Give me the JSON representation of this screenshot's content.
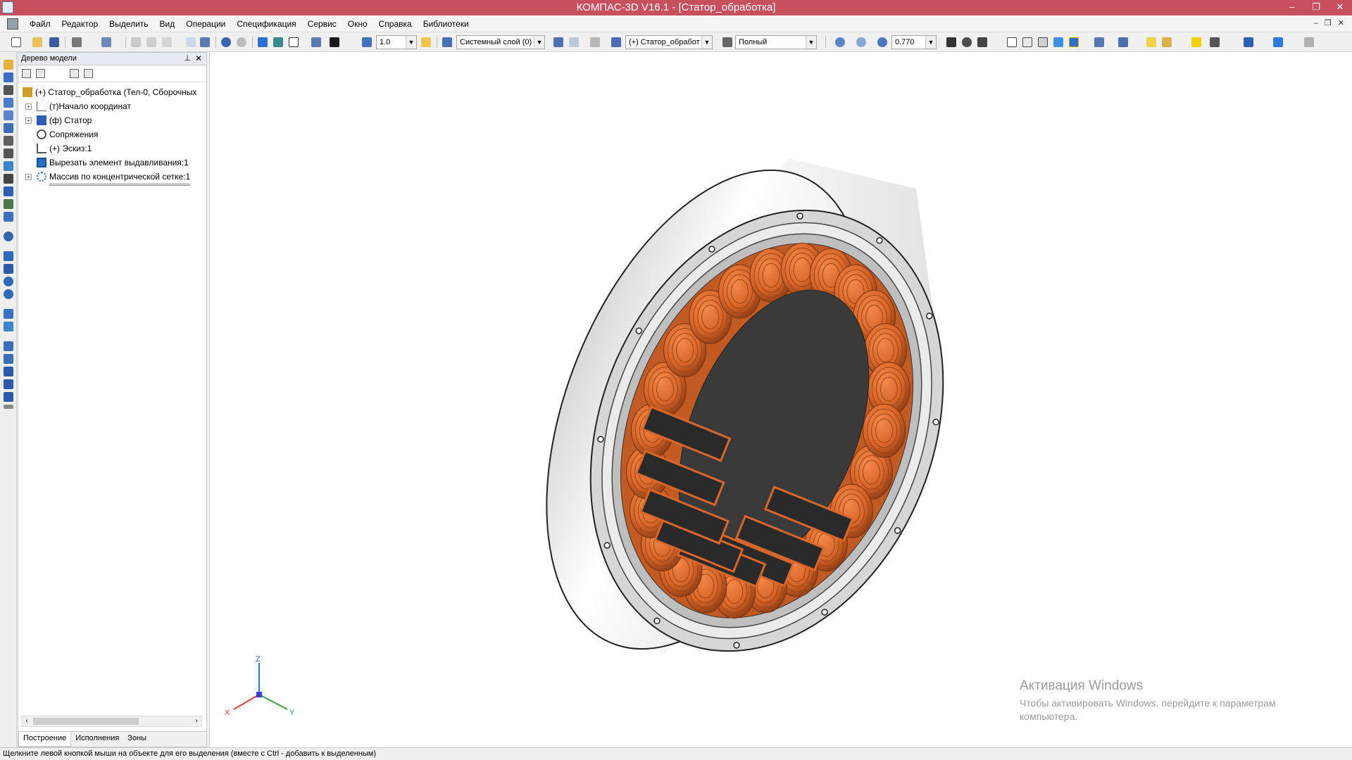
{
  "window": {
    "title": "КОМПАС-3D V16.1 - [Статор_обработка]",
    "controls": [
      "–",
      "❐",
      "✕"
    ]
  },
  "menu": [
    "Файл",
    "Редактор",
    "Выделить",
    "Вид",
    "Операции",
    "Спецификация",
    "Сервис",
    "Окно",
    "Справка",
    "Библиотеки"
  ],
  "mdi_controls": "– ❐ ✕",
  "toolbar": {
    "step_value": "1.0",
    "layer": "Системный слой (0)",
    "component": "(+) Статор_обработ",
    "display_mode": "Полный",
    "zoom": "0.770"
  },
  "tree": {
    "title": "Дерево модели",
    "pin": "⊥",
    "close": "✕",
    "nodes": [
      {
        "label": "(+) Статор_обработка (Тел-0, Сборочных"
      },
      {
        "label": "(т)Начало координат"
      },
      {
        "label": "(ф) Статор"
      },
      {
        "label": "Сопряжения"
      },
      {
        "label": "(+) Эскиз:1"
      },
      {
        "label": "Вырезать элемент выдавливания:1"
      },
      {
        "label": "Массив по концентрической сетке:1"
      }
    ],
    "tabs": [
      "Построение",
      "Исполнения",
      "Зоны"
    ]
  },
  "axes": {
    "z": "Z",
    "x": "X",
    "y": "Y"
  },
  "activation": {
    "title": "Активация Windows",
    "line1": "Чтобы активировать Windows, перейдите к параметрам",
    "line2": "компьютера."
  },
  "status": "Щелкните левой кнопкой мыши на объекте для его выделения (вместе с Ctrl - добавить к выделенным)",
  "colors": {
    "titlebar": "#c7505f",
    "copper": "#d9662a",
    "iron_core": "#2c2c2c",
    "housing": "#e6e6e6",
    "slot_insulation": "#5a5fa8"
  }
}
